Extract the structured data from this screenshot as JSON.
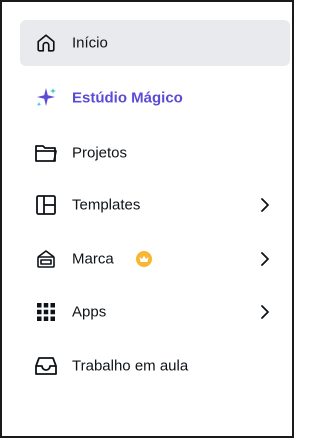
{
  "sidebar": {
    "items": [
      {
        "label": "Início",
        "icon": "home-icon",
        "active": true
      },
      {
        "label": "Estúdio Mágico",
        "icon": "sparkle-icon",
        "color": "#5b4bd6"
      },
      {
        "label": "Projetos",
        "icon": "folder-icon"
      },
      {
        "label": "Templates",
        "icon": "templates-icon",
        "has_submenu": true
      },
      {
        "label": "Marca",
        "icon": "brand-kit-icon",
        "badge": "crown-icon",
        "badge_color": "#f7b733",
        "has_submenu": true
      },
      {
        "label": "Apps",
        "icon": "apps-grid-icon",
        "has_submenu": true
      },
      {
        "label": "Trabalho em aula",
        "icon": "inbox-tray-icon"
      }
    ]
  },
  "colors": {
    "accent": "#5b4bd6",
    "active_bg": "#e9eaed",
    "crown": "#f7b733"
  }
}
